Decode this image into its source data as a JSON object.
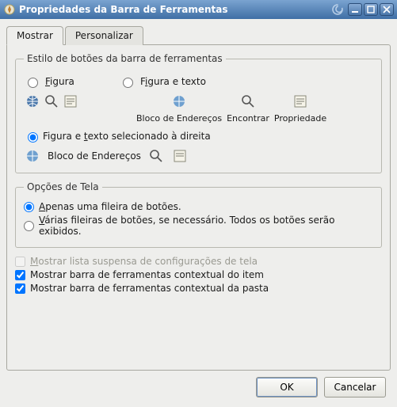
{
  "window": {
    "title": "Propriedades da Barra de Ferramentas"
  },
  "tabs": {
    "show": "Mostrar",
    "customize": "Personalizar"
  },
  "style_group": {
    "legend": "Estilo de botões da barra de ferramentas",
    "opt_figure": "Figura",
    "opt_figure_text": "Figura e texto",
    "opt_figure_text_right": "Figura e texto selecionado à direita",
    "icon_addr": "Bloco de Endereços",
    "icon_find": "Encontrar",
    "icon_props": "Propriedade",
    "icon_addr2": "Bloco de Endereços"
  },
  "screen_group": {
    "legend": "Opções de Tela",
    "opt_single": "Apenas uma fileira de botões.",
    "opt_multi": "Várias fileiras de botões, se necessário. Todos os botões serão exibidos."
  },
  "checks": {
    "dropdown": "Mostrar lista suspensa de configurações de tela",
    "item_ctx": "Mostrar barra de ferramentas contextual do item",
    "folder_ctx": "Mostrar barra de ferramentas contextual da pasta"
  },
  "buttons": {
    "ok": "OK",
    "cancel": "Cancelar"
  }
}
